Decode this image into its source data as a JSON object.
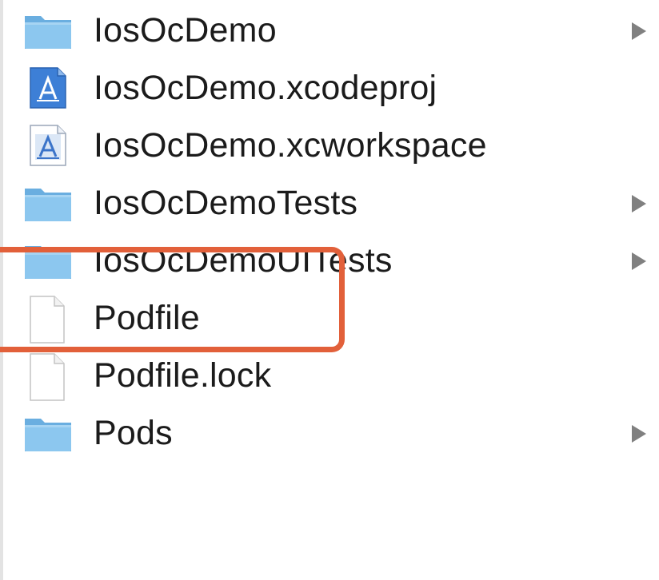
{
  "items": [
    {
      "name": "IosOcDemo",
      "kind": "folder",
      "expandable": true
    },
    {
      "name": "IosOcDemo.xcodeproj",
      "kind": "xcodeproj",
      "expandable": false
    },
    {
      "name": "IosOcDemo.xcworkspace",
      "kind": "xcworkspace",
      "expandable": false
    },
    {
      "name": "IosOcDemoTests",
      "kind": "folder",
      "expandable": true
    },
    {
      "name": "IosOcDemoUITests",
      "kind": "folder",
      "expandable": true
    },
    {
      "name": "Podfile",
      "kind": "file",
      "expandable": false
    },
    {
      "name": "Podfile.lock",
      "kind": "file",
      "expandable": false
    },
    {
      "name": "Pods",
      "kind": "folder",
      "expandable": true
    }
  ],
  "icons": {
    "folder": "folder-icon",
    "xcodeproj": "xcodeproj-icon",
    "xcworkspace": "xcworkspace-icon",
    "file": "document-icon",
    "disclosure": "disclosure-triangle-icon"
  },
  "colors": {
    "folder": "#7fbde8",
    "highlight": "#e2603a",
    "text": "#1b1b1b"
  }
}
